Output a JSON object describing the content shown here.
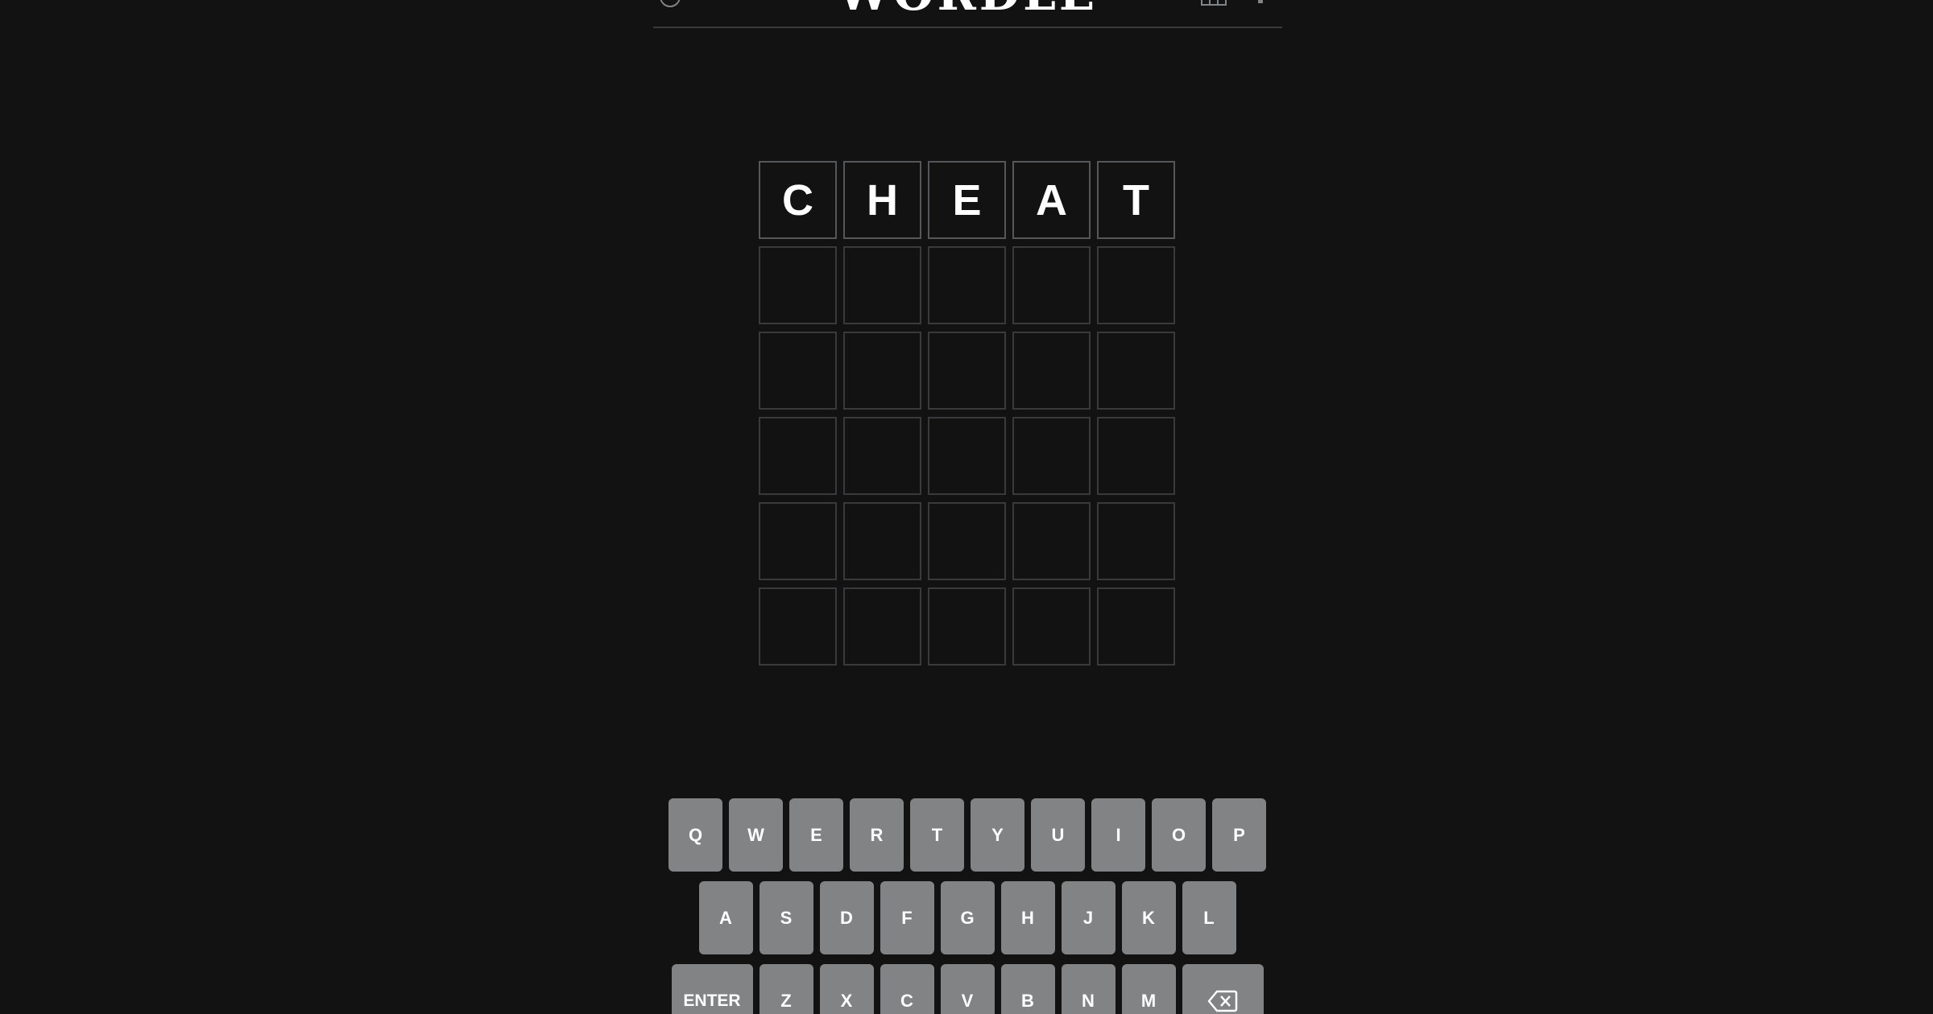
{
  "header": {
    "title": "WORDLE",
    "icons": [
      "help-icon",
      "stats-icon",
      "settings-icon"
    ]
  },
  "board": {
    "rows": [
      [
        "C",
        "H",
        "E",
        "A",
        "T"
      ],
      [
        "",
        "",
        "",
        "",
        ""
      ],
      [
        "",
        "",
        "",
        "",
        ""
      ],
      [
        "",
        "",
        "",
        "",
        ""
      ],
      [
        "",
        "",
        "",
        "",
        ""
      ],
      [
        "",
        "",
        "",
        "",
        ""
      ]
    ]
  },
  "keyboard": {
    "row1": [
      "Q",
      "W",
      "E",
      "R",
      "T",
      "Y",
      "U",
      "I",
      "O",
      "P"
    ],
    "row2": [
      "A",
      "S",
      "D",
      "F",
      "G",
      "H",
      "J",
      "K",
      "L"
    ],
    "row3": [
      "ENTER",
      "Z",
      "X",
      "C",
      "V",
      "B",
      "N",
      "M",
      "backspace"
    ]
  },
  "colors": {
    "background": "#121213",
    "tile_border_empty": "#3a3a3c",
    "tile_border_filled": "#565758",
    "key_background": "#818384",
    "text": "#ffffff"
  }
}
